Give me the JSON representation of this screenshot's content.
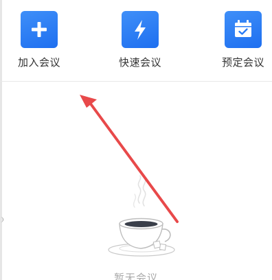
{
  "actions": [
    {
      "label": "加入会议",
      "icon": "plus-icon"
    },
    {
      "label": "快速会议",
      "icon": "lightning-icon"
    },
    {
      "label": "预定会议",
      "icon": "calendar-check-icon"
    }
  ],
  "empty_state": {
    "text": "暂无会议",
    "icon": "coffee-cup-icon"
  },
  "colors": {
    "accent": "#2a7cf6",
    "arrow": "#e8494a",
    "label": "#333333",
    "muted": "#a8a8a8"
  }
}
